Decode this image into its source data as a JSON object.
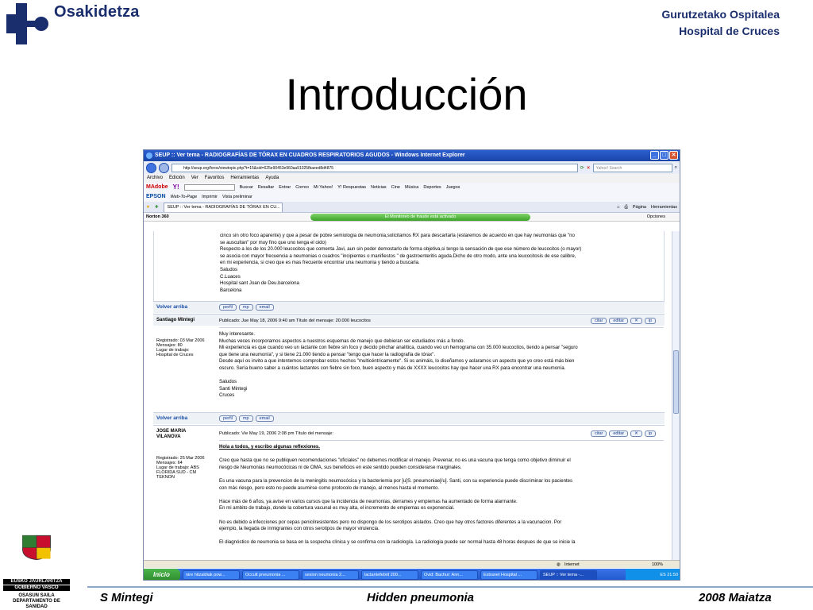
{
  "slide": {
    "org_logo_text": "Osakidetza",
    "hospital_line1": "Gurutzetako Ospitalea",
    "hospital_line2": "Hospital de Cruces",
    "title": "Introducción",
    "footer_left": "S Mintegi",
    "footer_center": "Hidden pneumonia",
    "footer_right": "2008 Maiatza",
    "gov_line1": "EUSKO JAURLARITZA",
    "gov_line2": "GOBIERNO VASCO",
    "gov_line3": "OSASUN SAILA",
    "gov_line4": "DEPARTAMENTO DE SANIDAD"
  },
  "browser": {
    "window_title": "SEUP :: Ver tema - RADIOGRAFÍAS DE TÓRAX EN CUADROS RESPIRATORIOS AGUDOS - Windows Internet Explorer",
    "url": "http://seup.org/foros/viewtopic.php?t=15&sid=625e90453e960aa91025fbaeed8d4875",
    "search_placeholder": "Yahoo! Search",
    "menu": [
      "Archivo",
      "Edición",
      "Ver",
      "Favoritos",
      "Herramientas",
      "Ayuda"
    ],
    "toolbar_brand": "MAdobe",
    "toolbar_items": [
      "Buscar",
      "Resaltar",
      "Entrar",
      "Correo",
      "Mi Yahoo!",
      "Y! Respuestas",
      "Noticias",
      "Cine",
      "Música",
      "Deportes",
      "Juegos"
    ],
    "epson_label": "EPSON",
    "webtopage_label": "Web-To-Page",
    "print_label": "Imprimir",
    "preview_label": "Vista preliminar",
    "tab_label": "SEUP :: Ver tema - RADIOGRAFÍAS DE TÓRAX EN CU...",
    "page_menu": "Página",
    "tools_menu": "Herramientas",
    "norton_label": "Norton 360",
    "fraud_monitor": "El Monitoreo de fraude está activado",
    "options_label": "Opciones",
    "status_zone": "Internet",
    "zoom": "100%"
  },
  "posts": {
    "p0_lines": [
      "cinco sin otro foco aparente) y que a pesar de pobre semiologia de neumonia,solicitamos RX para descartarla (estaremos de acuerdo en que hay neumonias que \"no",
      "se auscultan\" por muy fino que uno tenga el oido)",
      "Respecto a los de los 20.000 leucocitos que comenta Javi, aun sin poder demostarlo de forma objetiva,si tengo la sensación de que ese número de leucocitos (o mayor)",
      "se asocia con mayor frecuencia a neumonias o cuadros \"incipientes o manifiestos \" de gastroenteritis aguda.Dicho de otro modo, ante una leucocitosis de ese calibre,",
      "en mi experiencia, si creo que es mas frecuente encontrar una neumonia y tiendo a buscarla.",
      "Saludos",
      "C.Luaces",
      "Hospital sant Joan de Deu.barcelona",
      "Barcelona"
    ],
    "volver": "Volver arriba",
    "btn_perfil": "perfil",
    "btn_mp": "mp",
    "btn_email": "email",
    "btn_citar": "citar",
    "btn_editar": "editar",
    "p1_author": "Santiago Mintegi",
    "p1_meta": "Publicado: Jue May 18, 2006 9:40 am    Título del mensaje: 20.000 leucocitos",
    "p1_side": [
      "Registrado: 03 Mar 2006",
      "Mensajes: 80",
      "Lugar de trabajo:",
      "Hospital de Cruces"
    ],
    "p1_lines": [
      "Muy interesante.",
      "Muchas veces incorporamos aspectos a nuestros esquemas de manejo que debieran ser estudiados más a fondo.",
      "Mi experiencia es que cuando veo un lactante con fiebre sin foco y decido pinchar analítica, cuando veo un hemograma con 35.000 leucocitos, tiendo a pensar \"seguro",
      "que tiene una neumonía\", y si tiene 21.000 tiendo a pensar \"tengo que hacer la radiografía de tórax\".",
      "Desde aquí os invito a que intentemos comprobar estos hechos \"multicéntricamente\". Si os animáis, lo diseñamos y aclaramos un aspecto que yo creo está más bien",
      "oscuro. Sería bueno saber a cuántos lactantes con fiebre sin foco, buen aspecto y más de XXXX leucocitos hay que hacer una RX para encontrar una neumonía.",
      "",
      "Saludos",
      "Santi Mintegi",
      "Cruces"
    ],
    "p2_author1": "JOSE MARIA",
    "p2_author2": "VILANOVA",
    "p2_meta": "Publicado: Vie May 19, 2006 2:08 pm    Título del mensaje:",
    "p2_side": [
      "Registrado: 25 Mar 2006",
      "Mensajes: 64",
      "Lugar de trabajo: ABS",
      "FLORIDA SUD - CM",
      "TEKNON"
    ],
    "p2_heading": "Hola a todos, y escribo algunas reflexiones.",
    "p2_lines": [
      "Creo que hasta que no se publiquen recomendaciones \"oficiales\" no debemos modificar el manejo. Prevenar, no es una vacuna que tenga como objetivo diminuir el",
      "riesgo de Neumonias neumocócicas ni de OMA, sus beneficios en este sentido pueden considerarse marginales.",
      "",
      "Es una vacuna para la prevencion de la meningitis neumocócica y la bacteriemia por [u]S. pneumoniae[/u]. Santi, con su experiencia puede discriminar los pacientes",
      "con más riesgo, pero esto no puede asumirse como protocolo de manejo, al menos hasta el momento.",
      "",
      "Hace más de 6 años, ya avise en varios cursos que la incidencia de neumonías, derrames y empiemas ha aumentado de forma alarmante.",
      "En mi ambito de trabajo, donde la cobertura vacunal es muy alta, el incremento de empiemas es exponencial.",
      "",
      "No es debido a infecciones por cepas penicilresistentes pero no dispongo de los serotipos aislados. Creo que hay otros factores diferentes a la vacunacion. Por",
      "ejemplo, la llegada de inmigrantes con otros serotipos de mayor virulencia.",
      "",
      "El diagnóstico de neumonia se basa en la sospecha clínica y se confirma con la radiología. La radiologia puede ser normal hasta 48 horas despues de que se inicie la"
    ]
  },
  "taskbar": {
    "start": "Inicio",
    "tasks": [
      "nire hitzaldiak pow...",
      "Occult pneumonia ...",
      "sesion neumonia 2...",
      "lactantefebril 200...",
      "Ovid: Bachur: Ann...",
      "Extranet Hospital ...",
      "SEUP :: Ver tema -..."
    ],
    "lang": "ES",
    "time": "21:50"
  }
}
